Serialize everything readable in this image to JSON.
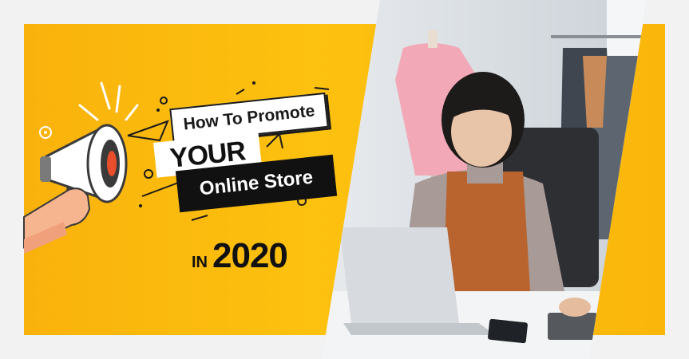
{
  "headline": {
    "line1": "How To Promote",
    "line2": "YOUR",
    "line3": "Online Store",
    "prefix": "IN",
    "year": "2020"
  },
  "colors": {
    "background": "#f2f2f2",
    "banner_yellow": "#fdc10f",
    "text_dark": "#111111",
    "label_white": "#ffffff"
  },
  "icons": [
    "megaphone-icon",
    "hand-icon"
  ]
}
